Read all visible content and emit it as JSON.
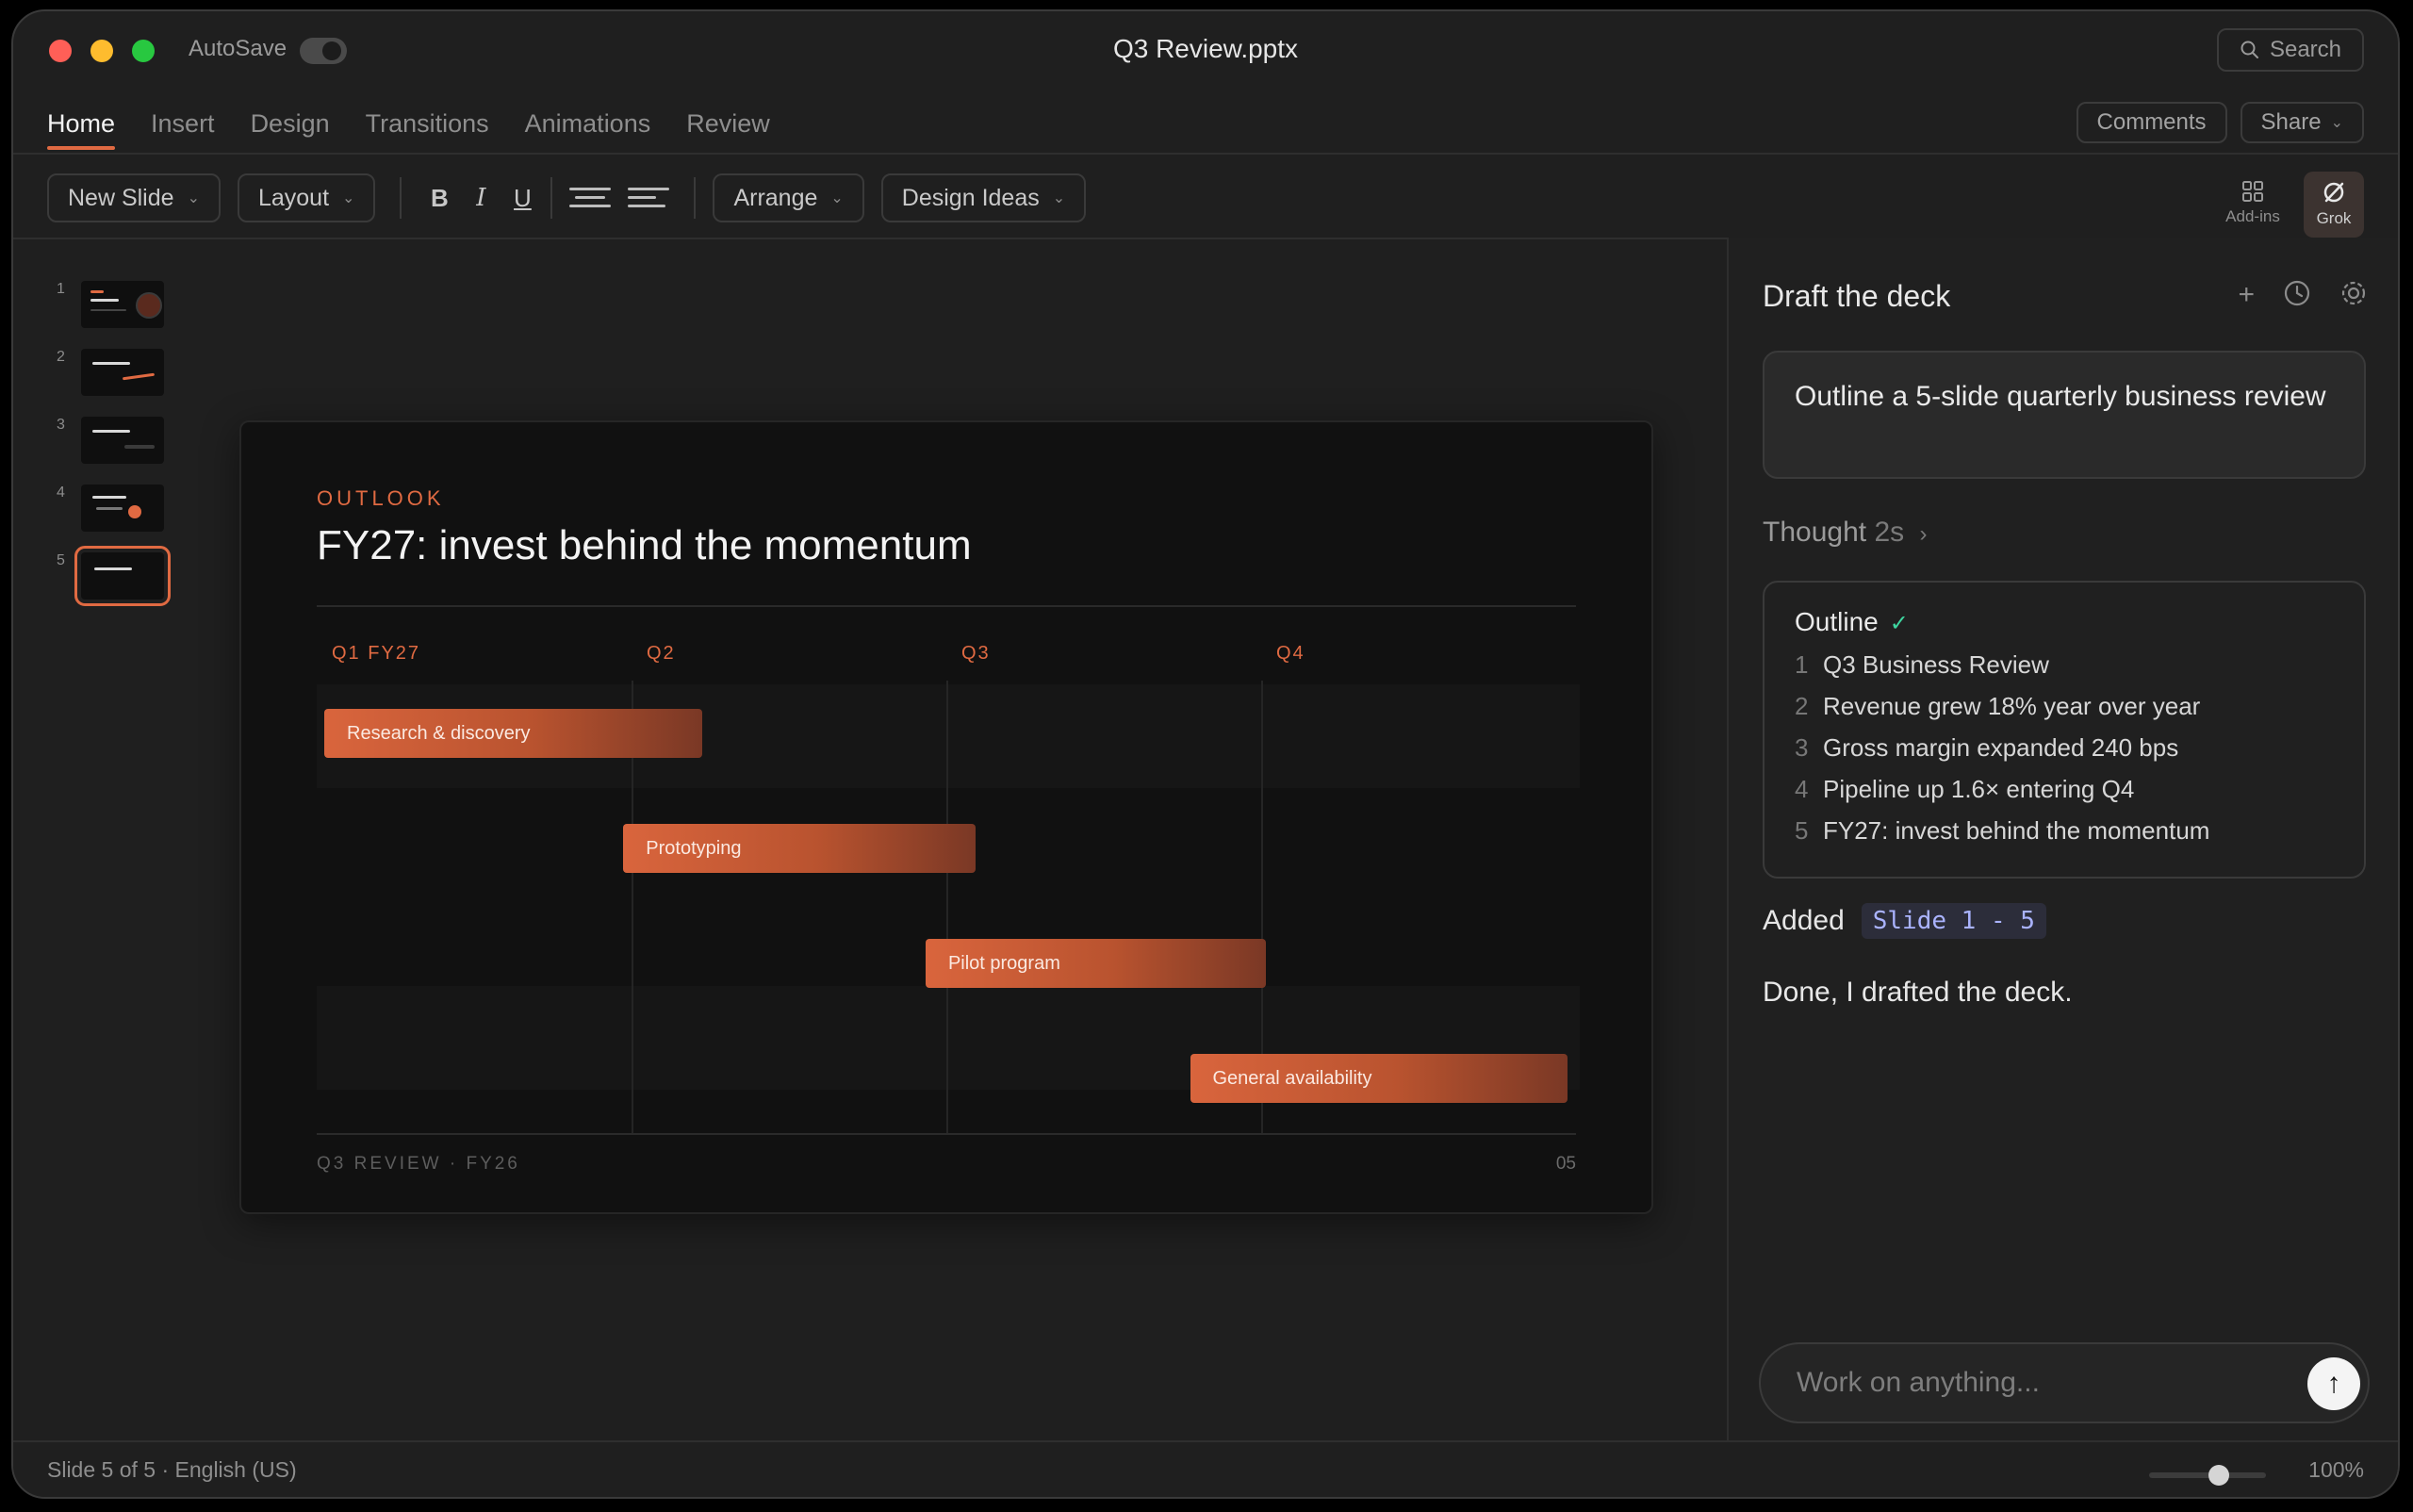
{
  "window": {
    "title": "Q3 Review.pptx",
    "autosave_label": "AutoSave",
    "search_label": "Search"
  },
  "ribbon": {
    "tabs": [
      "Home",
      "Insert",
      "Design",
      "Transitions",
      "Animations",
      "Review"
    ],
    "active_tab": "Home",
    "comments_label": "Comments",
    "share_label": "Share"
  },
  "toolbar": {
    "new_slide": "New Slide",
    "layout": "Layout",
    "bold": "B",
    "italic": "I",
    "underline": "U",
    "arrange": "Arrange",
    "design_ideas": "Design Ideas",
    "addins": "Add-ins",
    "grok": "Grok"
  },
  "thumbnails": [
    "1",
    "2",
    "3",
    "4",
    "5"
  ],
  "slide": {
    "kicker": "OUTLOOK",
    "title": "FY27: invest behind the momentum",
    "quarters": [
      "Q1 FY27",
      "Q2",
      "Q3",
      "Q4"
    ],
    "bars": [
      {
        "label": "Research & discovery",
        "start": 0.0,
        "end": 1.2
      },
      {
        "label": "Prototyping",
        "start": 0.95,
        "end": 2.07
      },
      {
        "label": "Pilot program",
        "start": 1.91,
        "end": 2.99
      },
      {
        "label": "General availability",
        "start": 2.75,
        "end": 3.95
      }
    ],
    "footer_left": "Q3 REVIEW · FY26",
    "footer_right": "05"
  },
  "panel": {
    "title": "Draft the deck",
    "prompt": "Outline a 5-slide quarterly business review",
    "thought": "Thought",
    "thought_time": "2s",
    "outline_title": "Outline",
    "outline_items": [
      {
        "num": "1",
        "text": "Q3 Business Review"
      },
      {
        "num": "2",
        "text": "Revenue grew 18% year over year"
      },
      {
        "num": "3",
        "text": "Gross margin expanded 240 bps"
      },
      {
        "num": "4",
        "text": "Pipeline up 1.6× entering Q4"
      },
      {
        "num": "5",
        "text": "FY27: invest behind the momentum"
      }
    ],
    "added_label": "Added",
    "added_chip": "Slide 1 - 5",
    "done_text": "Done, I drafted the deck.",
    "input_placeholder": "Work on anything..."
  },
  "status": {
    "slide_info": "Slide 5 of 5 · English (US)",
    "zoom": "100%",
    "zoom_level": 0.6
  },
  "colors": {
    "accent": "#e06a42",
    "check": "#3ed6a0"
  }
}
